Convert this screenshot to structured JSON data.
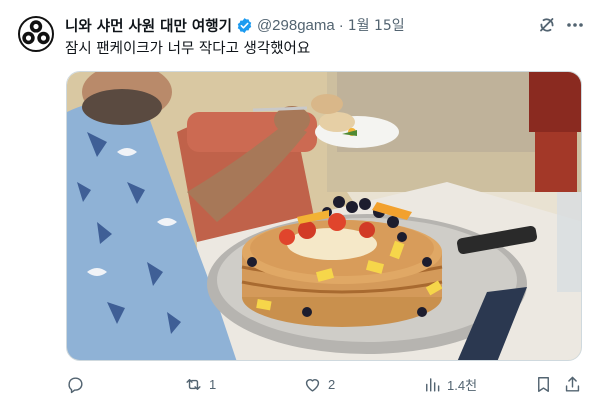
{
  "tweet": {
    "display_name": "니와 샤먼 사원 대만 여행기",
    "handle": "@298gama",
    "separator": "·",
    "date": "1월 15일",
    "text": "잠시 팬케이크가 너무 작다고 생각했어요",
    "media_description": "photo of a man eating next to a huge stack of pancakes topped with fruit"
  },
  "actions": {
    "reply_count": "",
    "retweet_count": "1",
    "like_count": "2",
    "views_count": "1.4천"
  },
  "colors": {
    "verified_blue": "#1d9bf0",
    "secondary_text": "#536471",
    "primary_text": "#0f1419"
  },
  "icons": {
    "avatar": "mon-crest-logo",
    "verified": "verified-badge-icon",
    "grok": "grok-icon",
    "more": "more-icon",
    "reply": "reply-icon",
    "retweet": "retweet-icon",
    "like": "like-icon",
    "views": "views-icon",
    "bookmark": "bookmark-icon",
    "share": "share-icon"
  }
}
